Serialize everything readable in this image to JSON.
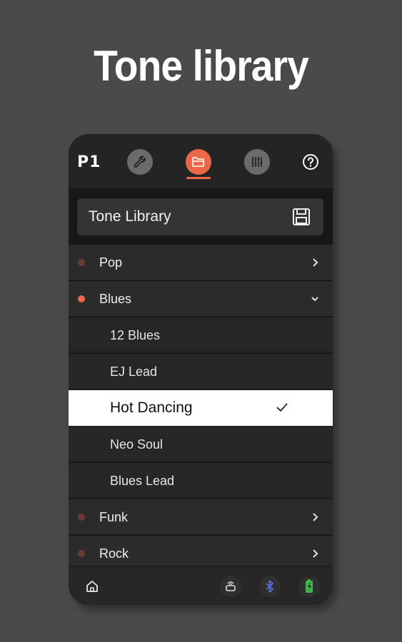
{
  "headline": "Tone library",
  "app": {
    "logo": "P1"
  },
  "nav": {
    "tabs": [
      {
        "name": "settings",
        "icon": "wrench-icon",
        "active": false
      },
      {
        "name": "library",
        "icon": "folder-icon",
        "active": true
      },
      {
        "name": "mixer",
        "icon": "sliders-icon",
        "active": false
      }
    ],
    "help_icon": "help-icon"
  },
  "library": {
    "title": "Tone Library",
    "save_icon": "save-icon",
    "categories": [
      {
        "label": "Pop",
        "expanded": false
      },
      {
        "label": "Blues",
        "expanded": true,
        "items": [
          {
            "label": "12 Blues",
            "selected": false
          },
          {
            "label": "EJ Lead",
            "selected": false
          },
          {
            "label": "Hot Dancing",
            "selected": true
          },
          {
            "label": "Neo Soul",
            "selected": false
          },
          {
            "label": "Blues Lead",
            "selected": false
          }
        ]
      },
      {
        "label": "Funk",
        "expanded": false
      },
      {
        "label": "Rock",
        "expanded": false
      }
    ]
  },
  "bottom_bar": {
    "icons": [
      "home-icon",
      "pedal-icon",
      "bluetooth-icon",
      "battery-icon"
    ]
  },
  "colors": {
    "accent": "#ea6849",
    "dot_inactive": "#6b3a33",
    "bluetooth": "#5a6ee0",
    "battery": "#3fb54a"
  }
}
